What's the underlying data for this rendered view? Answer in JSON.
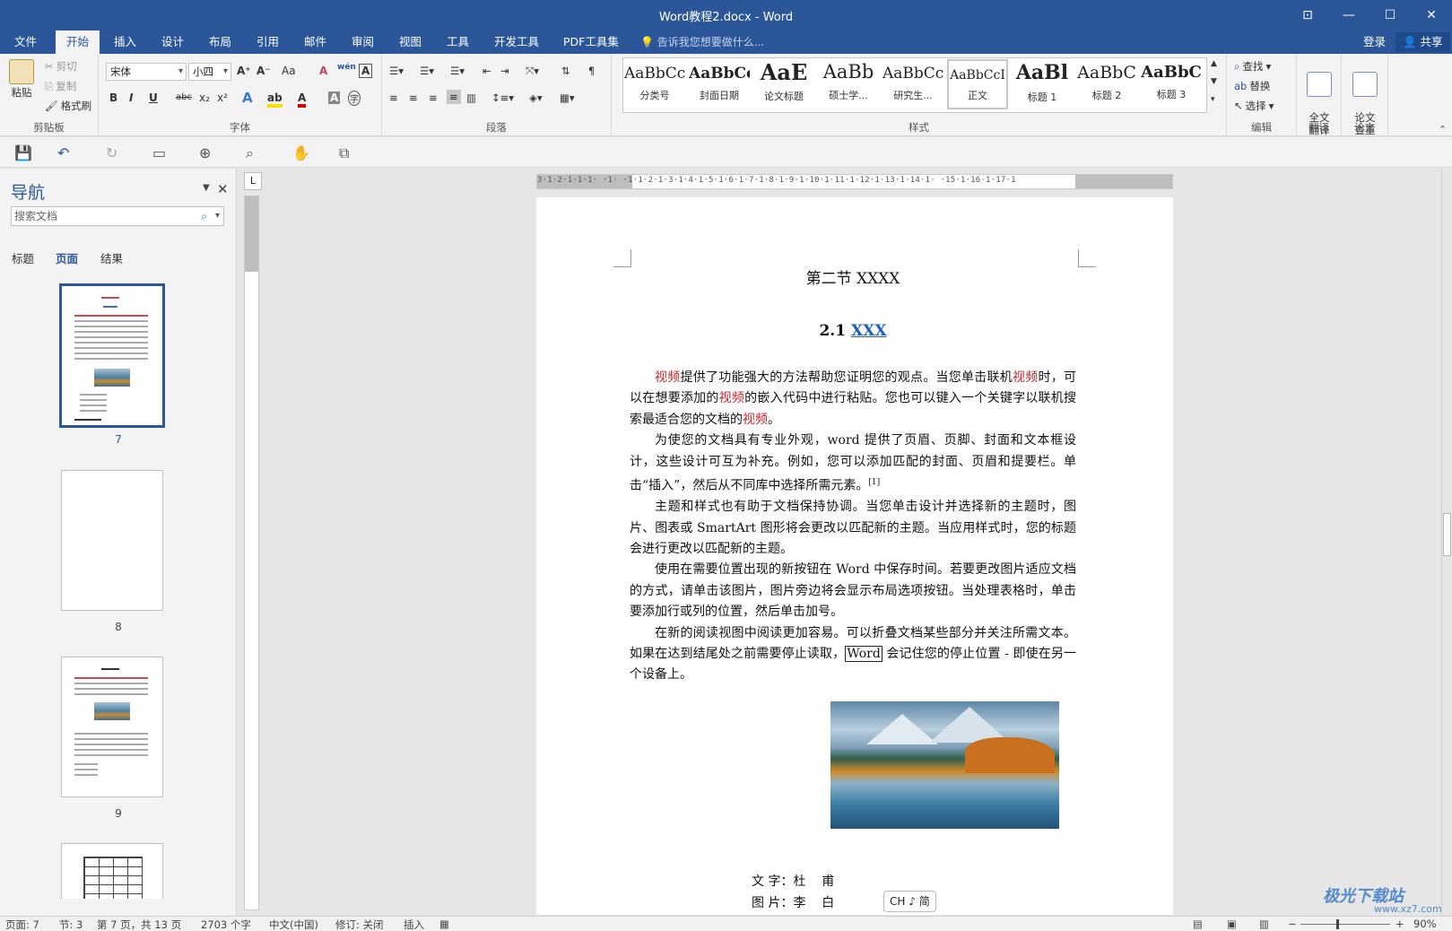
{
  "window": {
    "title": "Word教程2.docx - Word",
    "buttons": {
      "ribbon_opts": "⊡",
      "minimize": "—",
      "maximize": "☐",
      "close": "✕"
    }
  },
  "tabs": [
    "文件",
    "开始",
    "插入",
    "设计",
    "布局",
    "引用",
    "邮件",
    "审阅",
    "视图",
    "工具",
    "开发工具",
    "PDF工具集"
  ],
  "active_tab": "开始",
  "tell_me": "告诉我您想要做什么...",
  "login": "登录",
  "share": "共享",
  "clipboard": {
    "paste": "粘贴",
    "cut": "剪切",
    "copy": "复制",
    "format_painter": "格式刷",
    "label": "剪贴板"
  },
  "font": {
    "family": "宋体",
    "size": "小四",
    "bold": "B",
    "italic": "I",
    "underline": "U",
    "strike": "abc",
    "sub": "x₂",
    "sup": "x²",
    "grow": "A⁺",
    "shrink": "A⁻",
    "case": "Aa",
    "clear": "A",
    "phonetic": "wén",
    "border": "A",
    "effects": "A",
    "highlight": "ab",
    "color": "A",
    "shade": "A",
    "circle": "字",
    "label": "字体"
  },
  "paragraph": {
    "label": "段落"
  },
  "styles": {
    "items": [
      {
        "sample": "AaBbCc",
        "name": "分类号"
      },
      {
        "sample": "AaBbCc",
        "name": "封面日期"
      },
      {
        "sample": "AaE",
        "name": "论文标题"
      },
      {
        "sample": "AaBb",
        "name": "硕士学..."
      },
      {
        "sample": "AaBbCc",
        "name": "研究生..."
      },
      {
        "sample": "AaBbCcI",
        "name": "正文"
      },
      {
        "sample": "AaBl",
        "name": "标题 1"
      },
      {
        "sample": "AaBbC",
        "name": "标题 2"
      },
      {
        "sample": "AaBbC",
        "name": "标题 3"
      }
    ],
    "label": "样式"
  },
  "editing": {
    "find": "查找",
    "replace": "替换",
    "select": "选择",
    "label": "编辑"
  },
  "translate": {
    "button": "全文\n翻译",
    "label": "翻译"
  },
  "thesis": {
    "button": "论文\n查重",
    "label": "论文"
  },
  "qat": {
    "save": "💾",
    "undo": "↶",
    "redo": "↻",
    "tool1": "▭",
    "tool2": "⊕",
    "tool3": "⌕",
    "tool4": "✋",
    "tool5": "⧉"
  },
  "nav": {
    "title": "导航",
    "search_placeholder": "搜索文档",
    "tabs": [
      "标题",
      "页面",
      "结果"
    ],
    "active_tab": "页面",
    "pages": [
      "7",
      "8",
      "9"
    ]
  },
  "ruler": {
    "h_ticks": "3·1·2·1·1·1· ·1· ·1·1·2·1·3·1·4·1·5·1·6·1·7·1·8·1·9·1·10·1·11·1·12·1·13·1·14·1· ·15·1·16·1·17·1",
    "corner": "L"
  },
  "document": {
    "section_title": "第二节  XXXX",
    "subsection_num": "2.1 ",
    "subsection_link": "XXX",
    "p1_a": "视频",
    "p1_b": "提供了功能强大的方法帮助您证明您的观点。当您单击联机",
    "p1_c": "视频",
    "p1_d": "时，可以在想要添加的",
    "p1_e": "视频",
    "p1_f": "的嵌入代码中进行粘贴。您也可以键入一个关键字以联机搜索最适合您的文档的",
    "p1_g": "视频",
    "p1_h": "。",
    "p2": "为使您的文档具有专业外观，word 提供了页眉、页脚、封面和文本框设计，这些设计可互为补充。例如，您可以添加匹配的封面、页眉和提要栏。单击“插入”，然后从不同库中选择所需元素。",
    "p2_ref": "[1]",
    "p3": "主题和样式也有助于文档保持协调。当您单击设计并选择新的主题时，图片、图表或 SmartArt 图形将会更改以匹配新的主题。当应用样式时，您的标题会进行更改以匹配新的主题。",
    "p4": "使用在需要位置出现的新按钮在 Word 中保存时间。若要更改图片适应文档的方式，请单击该图片，图片旁边将会显示布局选项按钮。当处理表格时，单击要添加行或列的位置，然后单击加号。",
    "p5_a": "在新的阅读视图中阅读更加容易。可以折叠文档某些部分并关注所需文本。如果在达到结尾处之前需要停止读取，",
    "p5_word": "Word",
    "p5_b": " 会记住您的停止位置 - 即使在另一个设备上。",
    "credit1": "文 字：杜    甫",
    "credit2": "图 片：李    白"
  },
  "ime": "CH ♪ 简",
  "status": {
    "page": "页面: 7",
    "section": "节: 3",
    "page_of": "第 7 页，共 13 页",
    "words": "2703 个字",
    "lang": "中文(中国)",
    "track": "修订: 关闭",
    "insert": "插入",
    "macro": "▦",
    "zoom": "90%",
    "zoom_minus": "−",
    "zoom_plus": "+"
  },
  "watermark": {
    "line1": "极光下载站",
    "line2": "www.xz7.com"
  }
}
